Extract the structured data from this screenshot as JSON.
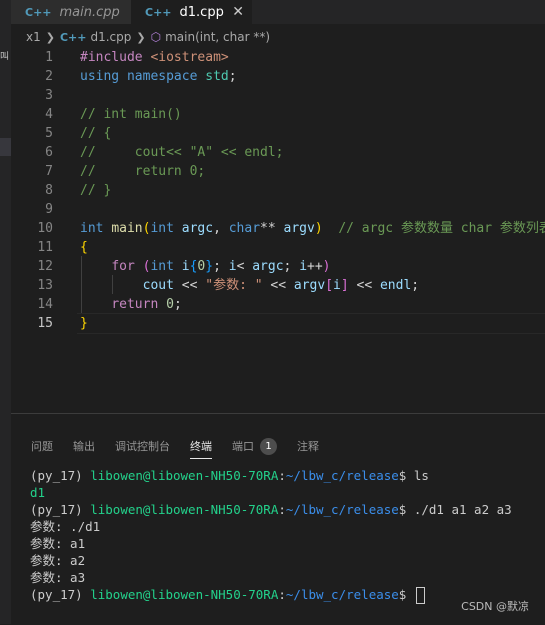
{
  "tabs": [
    {
      "icon": "C++",
      "label": "main.cpp",
      "active": false
    },
    {
      "icon": "C++",
      "label": "d1.cpp",
      "active": true,
      "close": "✕"
    }
  ],
  "left_strip_mark": "叫",
  "breadcrumb": {
    "root": "x1",
    "file": "d1.cpp",
    "symbol": "main(int, char **)"
  },
  "editor": {
    "line_numbers": [
      "1",
      "2",
      "3",
      "4",
      "5",
      "6",
      "7",
      "8",
      "9",
      "10",
      "11",
      "12",
      "13",
      "14",
      "15"
    ],
    "current_line": 15,
    "lines": [
      [
        {
          "t": "pp",
          "v": "#include "
        },
        {
          "t": "str",
          "v": "<iostream>"
        }
      ],
      [
        {
          "t": "kw",
          "v": "using"
        },
        {
          "t": "plain",
          "v": " "
        },
        {
          "t": "kw",
          "v": "namespace"
        },
        {
          "t": "plain",
          "v": " "
        },
        {
          "t": "ty",
          "v": "std"
        },
        {
          "t": "plain",
          "v": ";"
        }
      ],
      [],
      [
        {
          "t": "cm",
          "v": "// int main()"
        }
      ],
      [
        {
          "t": "cm",
          "v": "// {"
        }
      ],
      [
        {
          "t": "cm",
          "v": "//     cout<< \"A\" << endl;"
        }
      ],
      [
        {
          "t": "cm",
          "v": "//     return 0;"
        }
      ],
      [
        {
          "t": "cm",
          "v": "// }"
        }
      ],
      [],
      [
        {
          "t": "kw",
          "v": "int"
        },
        {
          "t": "plain",
          "v": " "
        },
        {
          "t": "fn",
          "v": "main"
        },
        {
          "t": "br",
          "v": "("
        },
        {
          "t": "kw",
          "v": "int"
        },
        {
          "t": "plain",
          "v": " "
        },
        {
          "t": "var",
          "v": "argc"
        },
        {
          "t": "plain",
          "v": ", "
        },
        {
          "t": "kw",
          "v": "char"
        },
        {
          "t": "plain",
          "v": "** "
        },
        {
          "t": "var",
          "v": "argv"
        },
        {
          "t": "br",
          "v": ")"
        },
        {
          "t": "plain",
          "v": "  "
        },
        {
          "t": "cm",
          "v": "// argc 参数数量 char 参数列表"
        }
      ],
      [
        {
          "t": "br",
          "v": "{"
        }
      ],
      [
        {
          "t": "plain",
          "v": "    "
        },
        {
          "t": "pp",
          "v": "for"
        },
        {
          "t": "plain",
          "v": " "
        },
        {
          "t": "br2",
          "v": "("
        },
        {
          "t": "kw",
          "v": "int"
        },
        {
          "t": "plain",
          "v": " "
        },
        {
          "t": "var",
          "v": "i"
        },
        {
          "t": "br3",
          "v": "{"
        },
        {
          "t": "num",
          "v": "0"
        },
        {
          "t": "br3",
          "v": "}"
        },
        {
          "t": "plain",
          "v": "; "
        },
        {
          "t": "var",
          "v": "i"
        },
        {
          "t": "plain",
          "v": "< "
        },
        {
          "t": "var",
          "v": "argc"
        },
        {
          "t": "plain",
          "v": "; "
        },
        {
          "t": "var",
          "v": "i"
        },
        {
          "t": "plain",
          "v": "++"
        },
        {
          "t": "br2",
          "v": ")"
        }
      ],
      [
        {
          "t": "plain",
          "v": "        "
        },
        {
          "t": "var",
          "v": "cout"
        },
        {
          "t": "plain",
          "v": " << "
        },
        {
          "t": "str",
          "v": "\"参数: \""
        },
        {
          "t": "plain",
          "v": " << "
        },
        {
          "t": "var",
          "v": "argv"
        },
        {
          "t": "br2",
          "v": "["
        },
        {
          "t": "var",
          "v": "i"
        },
        {
          "t": "br2",
          "v": "]"
        },
        {
          "t": "plain",
          "v": " << "
        },
        {
          "t": "var",
          "v": "endl"
        },
        {
          "t": "plain",
          "v": ";"
        }
      ],
      [
        {
          "t": "plain",
          "v": "    "
        },
        {
          "t": "pp",
          "v": "return"
        },
        {
          "t": "plain",
          "v": " "
        },
        {
          "t": "num",
          "v": "0"
        },
        {
          "t": "plain",
          "v": ";"
        }
      ],
      [
        {
          "t": "br",
          "v": "}"
        }
      ]
    ]
  },
  "panel": {
    "tabs": [
      "问题",
      "输出",
      "调试控制台",
      "终端",
      "端口",
      "注释"
    ],
    "active_tab": "终端",
    "ports_badge": "1"
  },
  "terminal": [
    [
      {
        "t": "plain",
        "v": "(py_17) "
      },
      {
        "t": "user",
        "v": "libowen@libowen-NH50-70RA"
      },
      {
        "t": "plain",
        "v": ":"
      },
      {
        "t": "path",
        "v": "~/lbw_c/release"
      },
      {
        "t": "plain",
        "v": "$ ls"
      }
    ],
    [
      {
        "t": "bin",
        "v": "d1"
      }
    ],
    [
      {
        "t": "plain",
        "v": "(py_17) "
      },
      {
        "t": "user",
        "v": "libowen@libowen-NH50-70RA"
      },
      {
        "t": "plain",
        "v": ":"
      },
      {
        "t": "path",
        "v": "~/lbw_c/release"
      },
      {
        "t": "plain",
        "v": "$ ./d1 a1 a2 a3"
      }
    ],
    [
      {
        "t": "plain",
        "v": "参数: ./d1"
      }
    ],
    [
      {
        "t": "plain",
        "v": "参数: a1"
      }
    ],
    [
      {
        "t": "plain",
        "v": "参数: a2"
      }
    ],
    [
      {
        "t": "plain",
        "v": "参数: a3"
      }
    ],
    [
      {
        "t": "plain",
        "v": "(py_17) "
      },
      {
        "t": "user",
        "v": "libowen@libowen-NH50-70RA"
      },
      {
        "t": "plain",
        "v": ":"
      },
      {
        "t": "path",
        "v": "~/lbw_c/release"
      },
      {
        "t": "plain",
        "v": "$ "
      },
      {
        "t": "cursor",
        "v": ""
      }
    ]
  ],
  "watermark": "CSDN @默凉"
}
